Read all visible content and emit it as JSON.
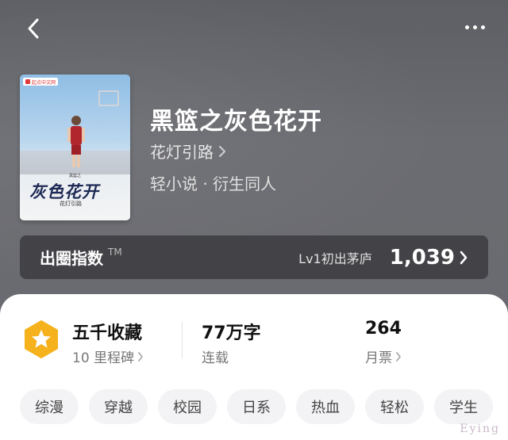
{
  "header": {
    "back_icon": "chevron-left-icon",
    "more_icon": "more-horizontal-icon"
  },
  "book": {
    "title": "黑篮之灰色花开",
    "author": "花灯引路",
    "genres": "轻小说 · 衍生同人",
    "cover": {
      "publisher": "起点中文网",
      "series": "黑篮之",
      "title": "灰色花开",
      "author": "花灯引路"
    }
  },
  "index": {
    "label": "出圈指数",
    "tm": "TM",
    "level": "Lv1初出茅庐",
    "value": "1,039"
  },
  "stats": {
    "collection_title": "五千收藏",
    "collection_sub": "10 里程碑",
    "words_title": "77万字",
    "words_sub": "连载",
    "tickets_title": "264",
    "tickets_sub": "月票"
  },
  "tags": [
    "综漫",
    "穿越",
    "校园",
    "日系",
    "热血",
    "轻松",
    "学生"
  ],
  "watermark": "Eying",
  "colors": {
    "badge": "#f5b21d",
    "badge_inner": "#ffffff"
  }
}
